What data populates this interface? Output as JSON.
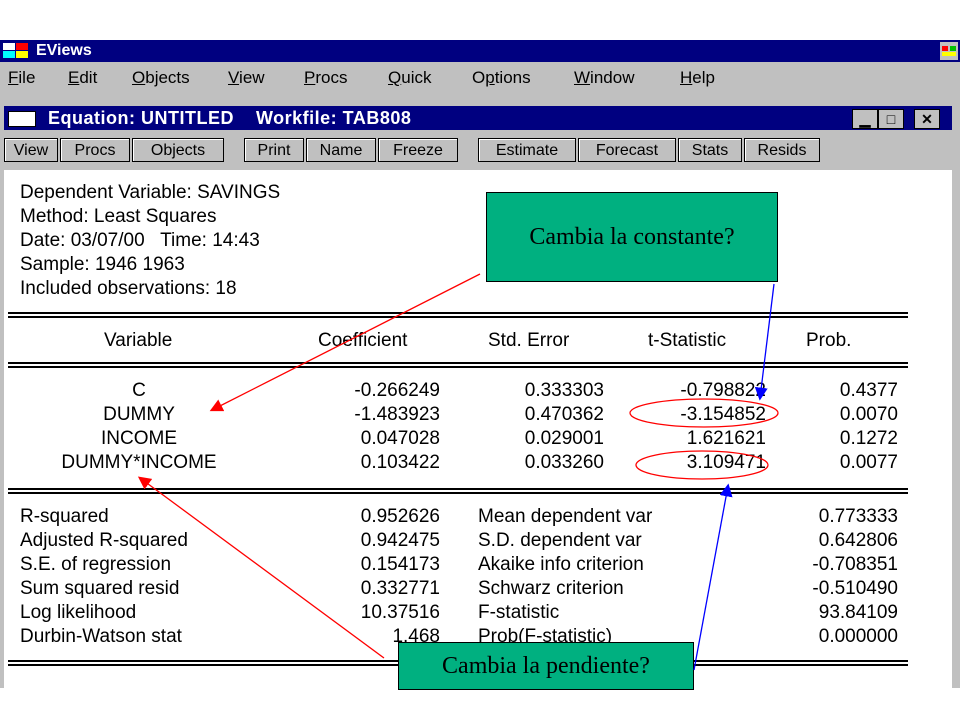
{
  "app": {
    "title": "EViews"
  },
  "menu": [
    "File",
    "Edit",
    "Objects",
    "View",
    "Procs",
    "Quick",
    "Options",
    "Window",
    "Help"
  ],
  "menu_accel": [
    "F",
    "E",
    "O",
    "V",
    "P",
    "Q",
    "p",
    "W",
    "H"
  ],
  "window": {
    "title": "Equation: UNTITLED    Workfile: TAB808"
  },
  "toolbar": [
    "View",
    "Procs",
    "Objects",
    "Print",
    "Name",
    "Freeze",
    "Estimate",
    "Forecast",
    "Stats",
    "Resids"
  ],
  "header": {
    "dependent": "Dependent Variable: SAVINGS",
    "method": "Method: Least Squares",
    "date": "Date: 03/07/00   Time: 14:43",
    "sample": "Sample: 1946 1963",
    "obs": "Included observations: 18"
  },
  "table": {
    "columns": [
      "Variable",
      "Coefficient",
      "Std. Error",
      "t-Statistic",
      "Prob."
    ],
    "rows": [
      [
        "C",
        "-0.266249",
        "0.333303",
        "-0.798822",
        "0.4377"
      ],
      [
        "DUMMY",
        "-1.483923",
        "0.470362",
        "-3.154852",
        "0.0070"
      ],
      [
        "INCOME",
        "0.047028",
        "0.029001",
        "1.621621",
        "0.1272"
      ],
      [
        "DUMMY*INCOME",
        "0.103422",
        "0.033260",
        "3.109471",
        "0.0077"
      ]
    ]
  },
  "stats": [
    [
      "R-squared",
      "0.952626",
      "Mean dependent var",
      "0.773333"
    ],
    [
      "Adjusted R-squared",
      "0.942475",
      "S.D. dependent var",
      "0.642806"
    ],
    [
      "S.E. of regression",
      "0.154173",
      "Akaike info criterion",
      "-0.708351"
    ],
    [
      "Sum squared resid",
      "0.332771",
      "Schwarz criterion",
      "-0.510490"
    ],
    [
      "Log likelihood",
      "10.37516",
      "F-statistic",
      "93.84109"
    ],
    [
      "Durbin-Watson stat",
      "1.468",
      "Prob(F-statistic)",
      "0.000000"
    ]
  ],
  "callouts": {
    "constant": "Cambia la constante?",
    "slope": "Cambia la pendiente?"
  },
  "colors": {
    "titlebar": "#000080",
    "chrome": "#c0c0c0",
    "callout": "#00b080",
    "arrow": "#ff0000",
    "arrow2": "#0000ff"
  }
}
